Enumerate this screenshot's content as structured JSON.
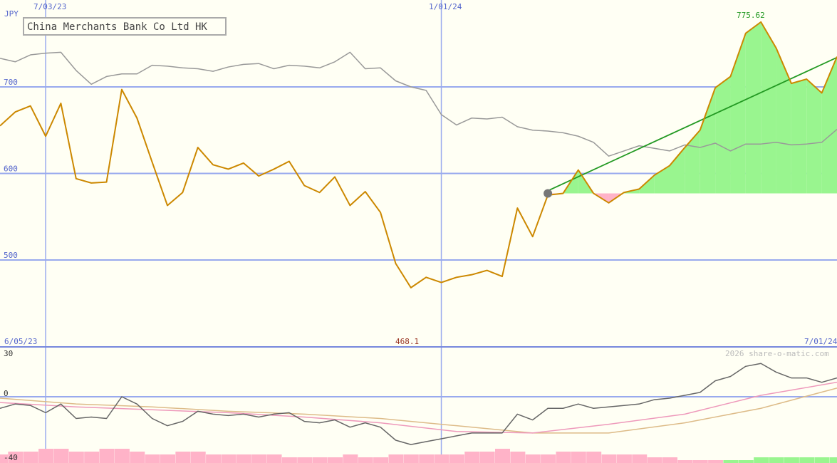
{
  "chart_data": [
    {
      "type": "line",
      "title": "China Merchants Bank Co Ltd HK",
      "ylabel": "JPY",
      "ylim": [
        450,
        800
      ],
      "y_ticks": [
        "700",
        "600",
        "500"
      ],
      "y_tick_values": [
        700,
        600,
        500
      ],
      "x_markers": [
        {
          "label": "7/03/23",
          "x": 3
        },
        {
          "label": "1/01/24",
          "x": 29
        }
      ],
      "x_range": [
        0,
        55
      ],
      "range_start": "6/05/23",
      "range_end": "7/01/24",
      "max_label": "775.62",
      "min_label": "468.1",
      "series": [
        {
          "name": "",
          "color": "#cc8800",
          "x": [
            0,
            1,
            2,
            3,
            4,
            5,
            6,
            7,
            8,
            9,
            10,
            11,
            12,
            13,
            14,
            15,
            16,
            17,
            18,
            19,
            20,
            21,
            22,
            23,
            24,
            25,
            26,
            27,
            28,
            29,
            30,
            31,
            32,
            33,
            34,
            35,
            36,
            37,
            38,
            39,
            40,
            41,
            42,
            43,
            44,
            45,
            46,
            47,
            48,
            49,
            50,
            51,
            52,
            53,
            54,
            55
          ],
          "y": [
            655,
            671,
            678,
            643,
            681,
            594,
            589,
            590,
            697,
            664,
            613,
            563,
            578,
            630,
            610,
            605,
            612,
            597,
            605,
            614,
            586,
            578,
            596,
            563,
            579,
            555,
            496,
            468,
            480,
            474,
            480,
            483,
            488,
            481,
            560,
            527,
            575,
            577,
            604,
            577,
            566,
            578,
            582,
            598,
            609,
            630,
            650,
            699,
            712,
            762,
            775,
            745,
            704,
            709,
            693,
            735
          ]
        },
        {
          "name": "",
          "color": "#999999",
          "x": [
            0,
            1,
            2,
            3,
            4,
            5,
            6,
            7,
            8,
            9,
            10,
            11,
            12,
            13,
            14,
            15,
            16,
            17,
            18,
            19,
            20,
            21,
            22,
            23,
            24,
            25,
            26,
            27,
            28,
            29,
            30,
            31,
            32,
            33,
            34,
            35,
            36,
            37,
            38,
            39,
            40,
            41,
            42,
            43,
            44,
            45,
            46,
            47,
            48,
            49,
            50,
            51,
            52,
            53,
            54,
            55
          ],
          "y": [
            733,
            729,
            737,
            739,
            740,
            719,
            703,
            712,
            715,
            715,
            725,
            724,
            722,
            721,
            718,
            723,
            726,
            727,
            721,
            725,
            724,
            722,
            729,
            740,
            721,
            722,
            707,
            700,
            696,
            668,
            656,
            664,
            663,
            665,
            654,
            650,
            649,
            647,
            643,
            636,
            620,
            626,
            632,
            629,
            626,
            633,
            630,
            635,
            626,
            634,
            634,
            636,
            633,
            634,
            636,
            651
          ]
        },
        {
          "name": "",
          "color": "#229922",
          "x": [
            36,
            55
          ],
          "y": [
            580,
            734
          ]
        }
      ],
      "reference": {
        "x": 36,
        "y": 577
      },
      "annotations": [
        "775.62",
        "468.1"
      ]
    },
    {
      "type": "line",
      "ylim": [
        -40,
        30
      ],
      "y_ticks": [
        "30",
        "0",
        "-40"
      ],
      "y_tick_values": [
        30,
        0,
        -40
      ],
      "watermark": "2026 share-o-matic.com",
      "series": [
        {
          "name": "",
          "color": "#666666",
          "x": [
            0,
            1,
            2,
            3,
            4,
            5,
            6,
            7,
            8,
            9,
            10,
            11,
            12,
            13,
            14,
            15,
            16,
            17,
            18,
            19,
            20,
            21,
            22,
            23,
            24,
            25,
            26,
            27,
            28,
            29,
            30,
            31,
            32,
            33,
            34,
            35,
            36,
            37,
            38,
            39,
            40,
            41,
            42,
            43,
            44,
            45,
            46,
            47,
            48,
            49,
            50,
            51,
            52,
            53,
            54,
            55
          ],
          "y": [
            -8,
            -5,
            -6,
            -11,
            -5,
            -15,
            -14,
            -15,
            0,
            -5,
            -15,
            -20,
            -17,
            -10,
            -12,
            -13,
            -12,
            -14,
            -12,
            -11,
            -17,
            -18,
            -16,
            -21,
            -18,
            -21,
            -30,
            -33,
            -31,
            -29,
            -27,
            -25,
            -25,
            -25,
            -12,
            -16,
            -8,
            -8,
            -5,
            -8,
            -7,
            -6,
            -5,
            -2,
            -1,
            1,
            3,
            11,
            14,
            21,
            23,
            17,
            13,
            13,
            10,
            13
          ]
        },
        {
          "name": "",
          "color": "#ee99bb",
          "x": [
            0,
            5,
            10,
            15,
            20,
            25,
            30,
            35,
            40,
            45,
            50,
            55
          ],
          "y": [
            -4,
            -7,
            -9,
            -11,
            -14,
            -18,
            -24,
            -25,
            -19,
            -12,
            1,
            10
          ]
        },
        {
          "name": "",
          "color": "#ddbb88",
          "x": [
            0,
            5,
            10,
            15,
            20,
            25,
            30,
            35,
            40,
            45,
            50,
            55
          ],
          "y": [
            -1,
            -5,
            -7,
            -10,
            -12,
            -15,
            -20,
            -25,
            -25,
            -18,
            -8,
            6
          ]
        }
      ]
    }
  ]
}
